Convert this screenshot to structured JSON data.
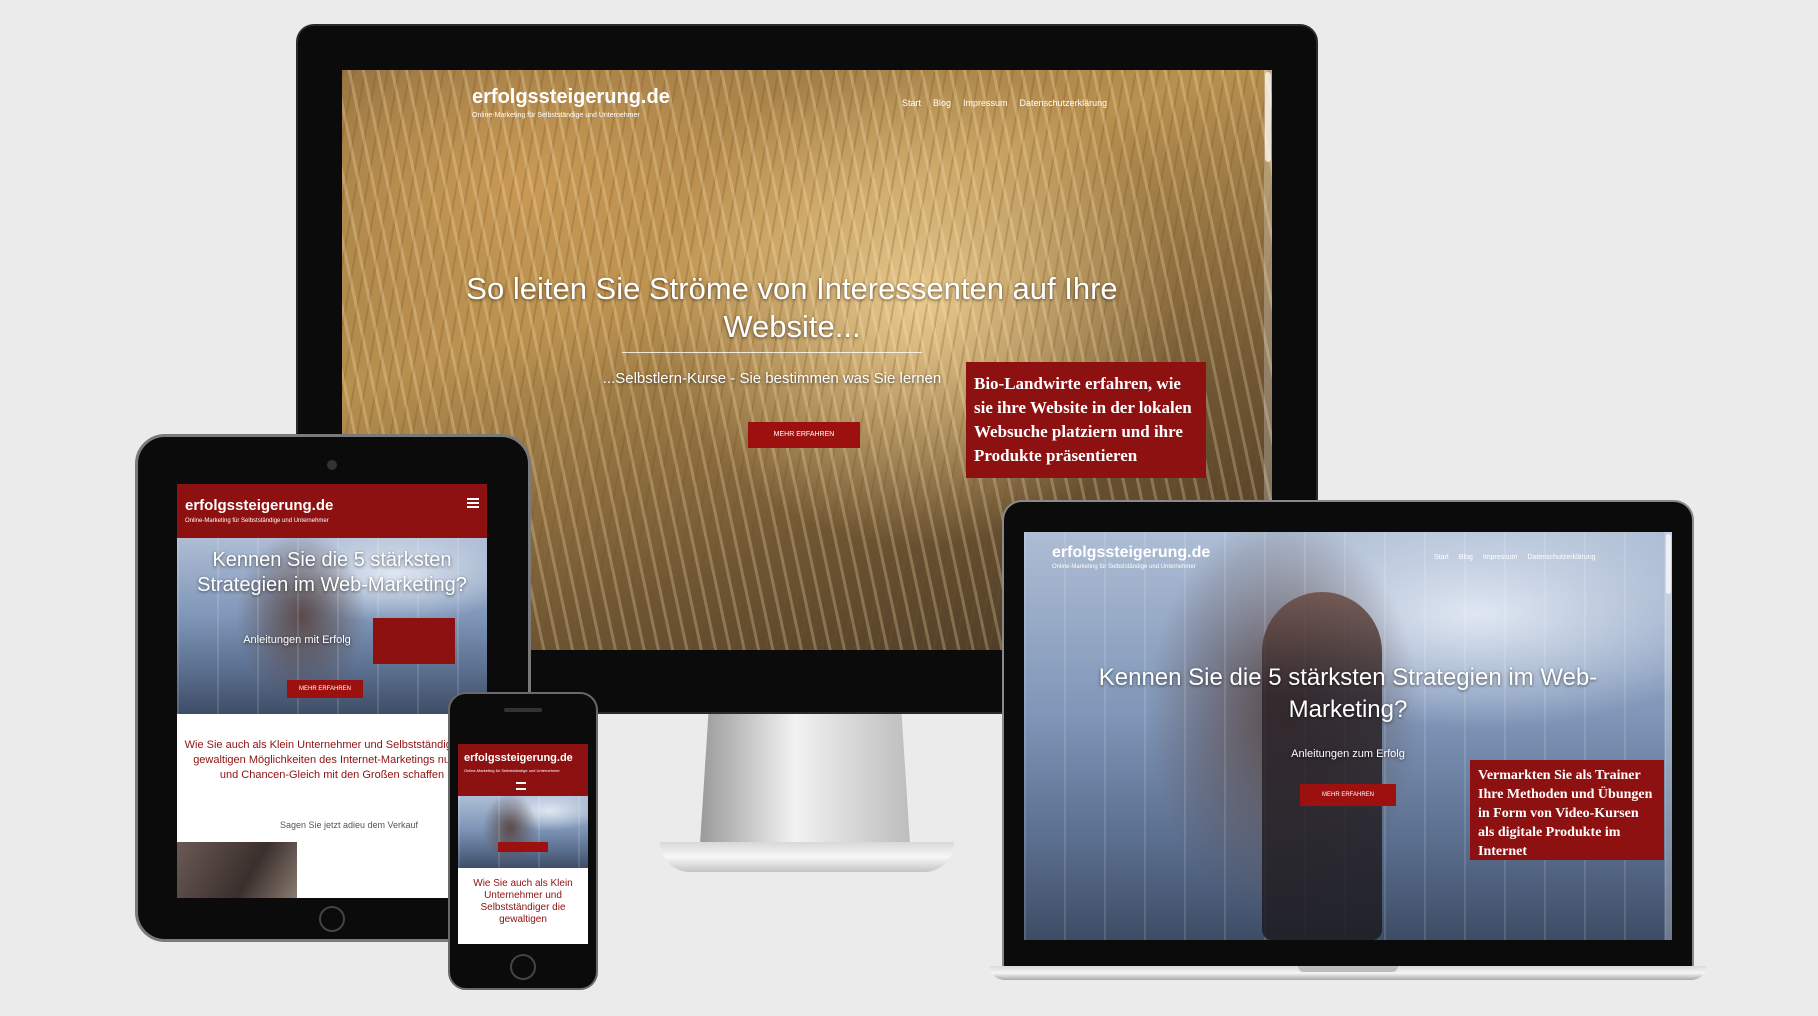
{
  "site": {
    "brand": "erfolgssteigerung.de",
    "tagline": "Online-Marketing für Selbstständige und Unternehmer"
  },
  "desktop": {
    "nav": [
      "Start",
      "Blog",
      "Impressum",
      "Datenschutzerklärung"
    ],
    "hero_title": "So leiten Sie Ströme von Interessenten auf Ihre Website...",
    "hero_subtitle": "...Selbstlern-Kurse - Sie bestimmen was Sie lernen",
    "hero_button": "MEHR ERFAHREN",
    "promo_box": "Bio-Landwirte erfahren, wie sie ihre Website in der lokalen Websuche platziern und ihre Produkte präsentieren"
  },
  "laptop": {
    "nav": [
      "Start",
      "Blog",
      "Impressum",
      "Datenschutzerklärung"
    ],
    "hero_title": "Kennen Sie die 5 stärksten Strategien im Web-Marketing?",
    "hero_subtitle": "Anleitungen zum Erfolg",
    "hero_button": "MEHR ERFAHREN",
    "promo_box": "Vermarkten Sie als Trainer Ihre Methoden und Übungen in Form von Video-Kursen als digitale Produkte im Internet"
  },
  "tablet": {
    "hero_title": "Kennen Sie die 5 stärksten Strategien im Web-Marketing?",
    "hero_subtitle": "Anleitungen mit Erfolg",
    "hero_button": "MEHR ERFAHREN",
    "body_text": "Wie Sie auch als Klein Unternehmer und Selbstständiger die gewaltigen Möglichkeiten des Internet-Marketings nutzen und Chancen-Gleich mit den Großen schaffen",
    "small_text": "Sagen Sie jetzt adieu dem Verkauf"
  },
  "phone": {
    "body_text": "Wie Sie auch als Klein Unternehmer und Selbstständiger die gewaltigen"
  },
  "colors": {
    "accent_red": "#8e1111",
    "background": "#ebebeb",
    "bezel": "#0b0b0b"
  },
  "icons": {
    "menu": "hamburger-menu-icon",
    "home": "home-button-icon"
  }
}
